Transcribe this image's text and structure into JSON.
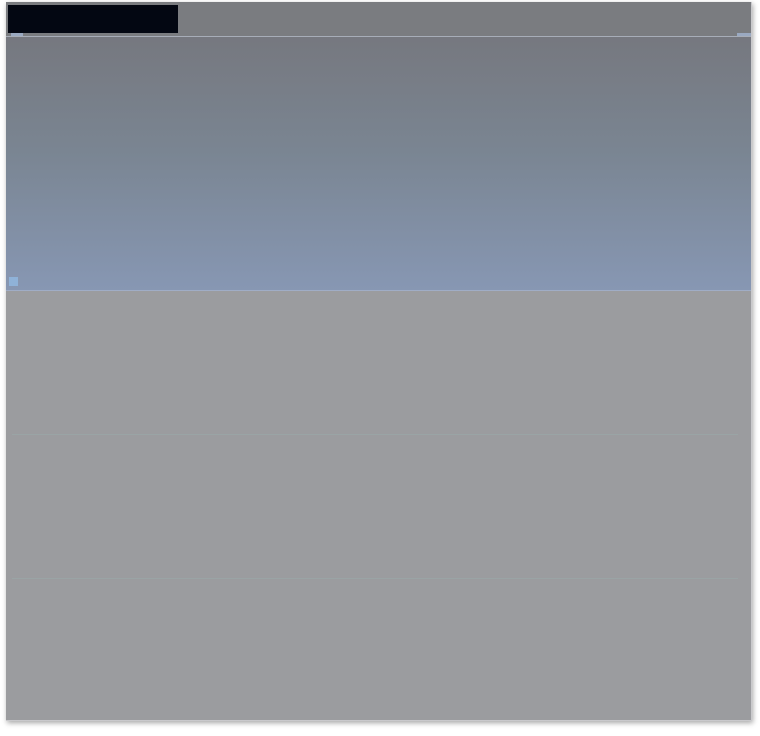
{
  "window": {
    "title": ""
  },
  "colors": {
    "title_block": "#030712",
    "topbar": "#7a7c80",
    "sky_top": "#76787f",
    "sky_bottom": "#8797b3",
    "lower_panel": "#9b9c9f",
    "marker": "#8fb2d8"
  }
}
